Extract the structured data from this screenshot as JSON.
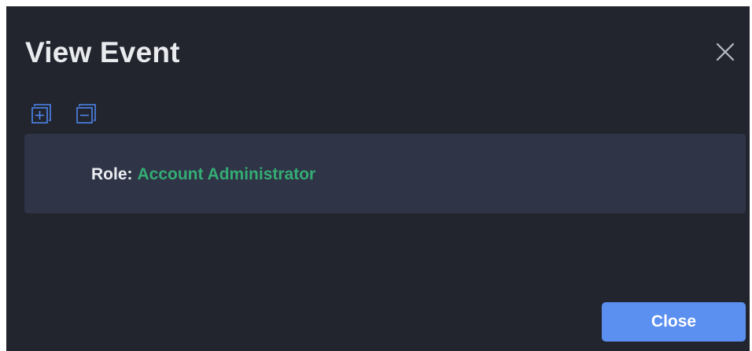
{
  "dialog": {
    "title": "View Event",
    "close_icon": "close-icon",
    "toolbar": {
      "expand_icon": "expand-all-icon",
      "collapse_icon": "collapse-all-icon"
    },
    "detail": {
      "label": "Role:",
      "value": "Account Administrator"
    },
    "footer": {
      "close_label": "Close"
    }
  },
  "colors": {
    "background": "#22252d",
    "panel": "#2f3447",
    "accent": "#5b8ff0",
    "value_text": "#34ad74"
  }
}
